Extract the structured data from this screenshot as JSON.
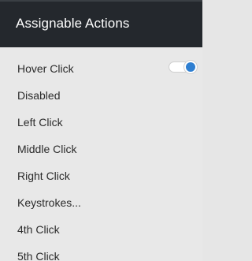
{
  "header": {
    "title": "Assignable Actions"
  },
  "menu": {
    "items": [
      {
        "label": "Hover Click"
      },
      {
        "label": "Disabled"
      },
      {
        "label": "Left Click"
      },
      {
        "label": "Middle Click"
      },
      {
        "label": "Right Click"
      },
      {
        "label": "Keystrokes..."
      },
      {
        "label": "4th Click"
      },
      {
        "label": "5th Click"
      }
    ],
    "hover_click_toggle": {
      "on": true,
      "accent": "#2f7fd1"
    }
  },
  "colors": {
    "header_bg": "#24282d",
    "menu_bg": "#e8e8e8",
    "text": "#2b2b2b"
  }
}
